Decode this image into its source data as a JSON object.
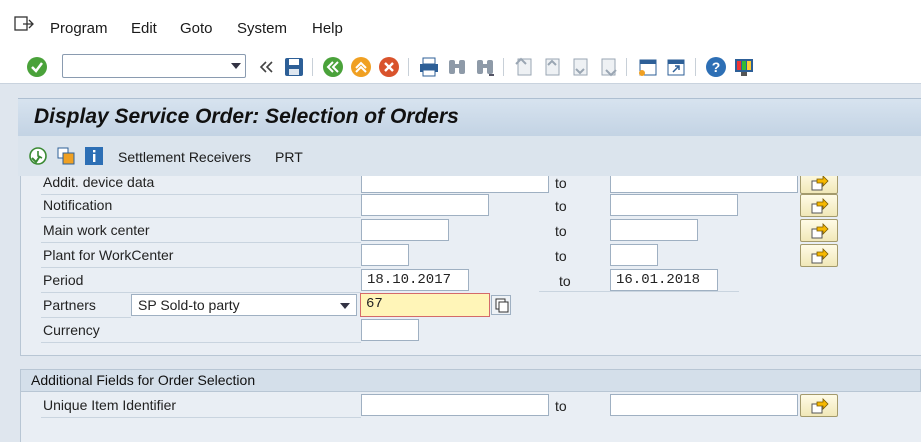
{
  "menu": {
    "items": [
      "Program",
      "Edit",
      "Goto",
      "System",
      "Help"
    ]
  },
  "toolbar": {
    "command_value": ""
  },
  "title": "Display Service Order: Selection of Orders",
  "app_toolbar": {
    "settlement_receivers": "Settlement Receivers",
    "prt": "PRT"
  },
  "fields": [
    {
      "label": "Addit. device data",
      "low": "",
      "to": "to",
      "high": ""
    },
    {
      "label": "Notification",
      "low": "",
      "to": "to",
      "high": ""
    },
    {
      "label": "Main work center",
      "low": "",
      "to": "to",
      "high": ""
    },
    {
      "label": "Plant for WorkCenter",
      "low": "",
      "to": "to",
      "high": ""
    },
    {
      "label": "Period",
      "low": "18.10.2017",
      "to": "to",
      "high": "16.01.2018"
    },
    {
      "label": "Partners",
      "partner_function": "SP Sold-to party",
      "low": "67"
    },
    {
      "label": "Currency",
      "low": ""
    }
  ],
  "additional": {
    "header": "Additional Fields for Order Selection",
    "field": {
      "label": "Unique Item Identifier",
      "low": "",
      "to": "to",
      "high": ""
    }
  },
  "colors": {
    "highlight_field": "#fff5b8",
    "title_bg": "#c9d8e8",
    "screen_bg": "#e9eef4"
  }
}
